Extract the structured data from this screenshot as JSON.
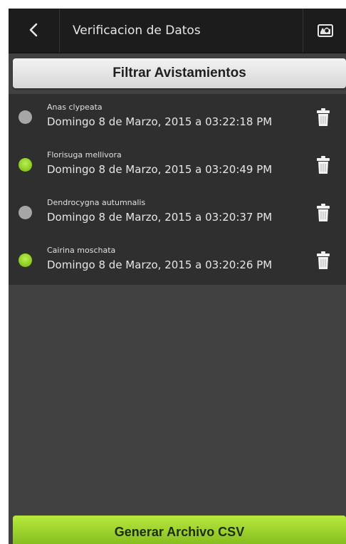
{
  "header": {
    "title": "Verificacion de Datos",
    "back_icon": "chevron-left-icon",
    "map_icon": "map-icon"
  },
  "filter_button": {
    "label": "Filtrar Avistamientos"
  },
  "sightings": [
    {
      "species": "Anas clypeata",
      "datetime": "Domingo 8 de Marzo, 2015 a 03:22:18 PM",
      "status": "grey"
    },
    {
      "species": "Florisuga mellivora",
      "datetime": "Domingo 8 de Marzo, 2015 a 03:20:49 PM",
      "status": "green"
    },
    {
      "species": "Dendrocygna autumnalis",
      "datetime": "Domingo 8 de Marzo, 2015 a 03:20:37 PM",
      "status": "grey"
    },
    {
      "species": "Cairina moschata",
      "datetime": "Domingo 8 de Marzo, 2015 a 03:20:26 PM",
      "status": "green"
    }
  ],
  "csv_button": {
    "label": "Generar Archivo CSV"
  },
  "colors": {
    "accent_green": "#8fcf1f",
    "status_grey": "#a6a6a6",
    "header_bg": "#1c1c1c",
    "list_bg": "#2f2f2f",
    "screen_bg": "#414141"
  }
}
